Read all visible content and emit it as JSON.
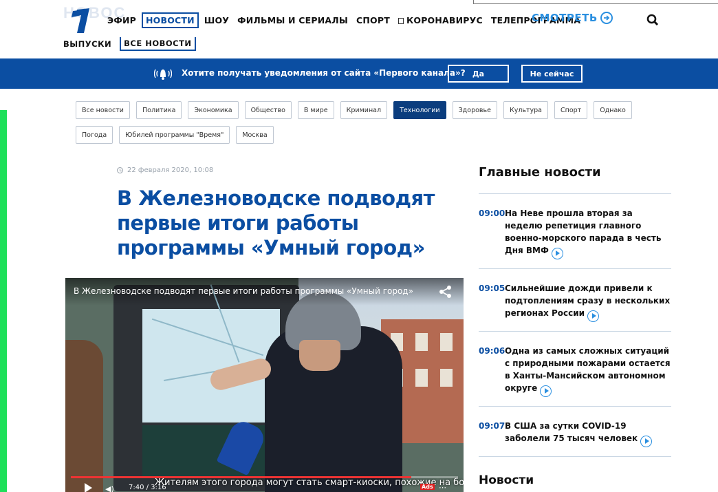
{
  "nav": {
    "logo_label": "1",
    "watermark": "НОВОС",
    "items": [
      "ЭФИР",
      "НОВОСТИ",
      "ШОУ",
      "ФИЛЬМЫ И СЕРИАЛЫ",
      "СПОРТ",
      "КОРОНАВИРУС",
      "ТЕЛЕПРОГРАММА"
    ],
    "active": "НОВОСТИ",
    "watch_label": "СМОТРЕТЬ",
    "sub_items": [
      "ВЫПУСКИ",
      "ВСЕ НОВОСТИ"
    ]
  },
  "notification": {
    "text": "Хотите получать уведомления от сайта «Первого канала»?",
    "yes": "Да",
    "no": "Не сейчас"
  },
  "categories": [
    "Все новости",
    "Политика",
    "Экономика",
    "Общество",
    "В мире",
    "Криминал",
    "Технологии",
    "Здоровье",
    "Культура",
    "Спорт",
    "Однако",
    "Погода",
    "Юбилей программы \"Время\"",
    "Москва"
  ],
  "active_category": "Технологии",
  "article": {
    "date": "22 февраля 2020, 10:08",
    "headline": "В Железноводске подводят первые итоги работы программы «Умный город»"
  },
  "video": {
    "title": "В Железноводске подводят первые итоги работы программы «Умный город»",
    "subtitle": "Жителям этого города могут стать смарт-киоски, похожие на большие смарт",
    "time": "7:40 / 3:16",
    "ads_badge": "Ads",
    "progress": 0.88
  },
  "sidebar": {
    "title": "Главные новости",
    "items": [
      {
        "time": "09:00",
        "text": "На Неве прошла вторая за неделю репетиция главного военно-морского парада в честь Дня ВМФ"
      },
      {
        "time": "09:05",
        "text": "Сильнейшие дожди привели к подтоплениям сразу в нескольких регионах России"
      },
      {
        "time": "09:06",
        "text": "Одна из самых сложных ситуаций с природными пожарами остается в Ханты-Мансийском автономном округе"
      },
      {
        "time": "09:07",
        "text": "В США за сутки COVID-19 заболели 75 тысяч человек"
      }
    ],
    "section2_title": "Новости"
  },
  "colors": {
    "brand": "#0b4ea2",
    "accent": "#2a8fe0",
    "green_marker": "#1ee05a"
  }
}
